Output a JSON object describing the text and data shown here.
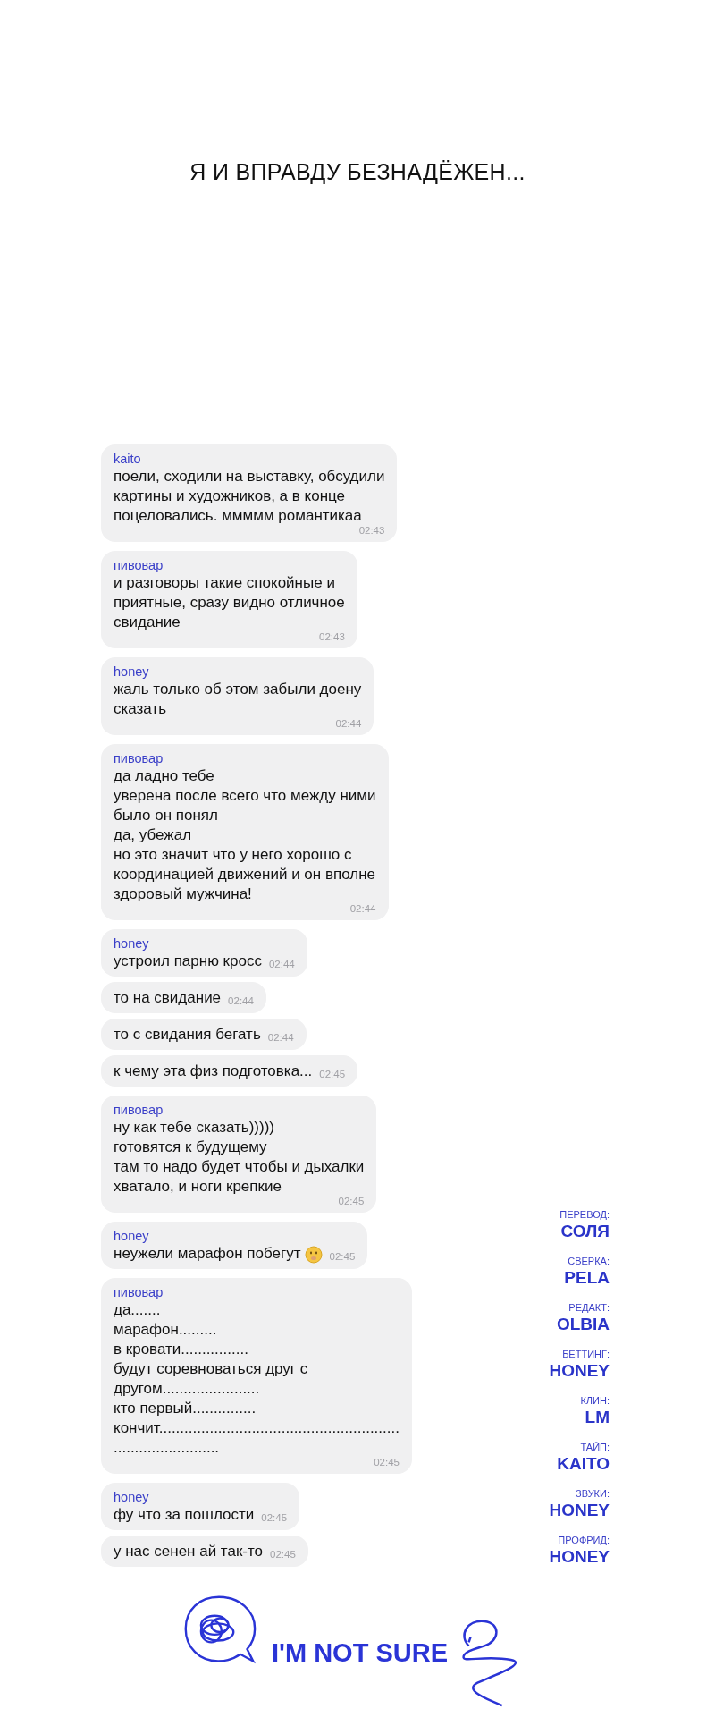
{
  "title": "Я И ВПРАВДУ БЕЗНАДЁЖЕН...",
  "messages": [
    {
      "sender": "kaito",
      "text": "поели, сходили на выставку, обсудили\nкартины и художников, а в конце\nпоцеловались. ммммм романтикаа",
      "time": "02:43",
      "emoji_icon": false
    },
    {
      "sender": "пивовар",
      "text": "и разговоры такие спокойные и\nприятные, сразу видно отличное\nсвидание",
      "time": "02:43",
      "emoji_icon": false
    },
    {
      "sender": "honey",
      "text": "жаль только об этом забыли доену\nсказать",
      "time": "02:44",
      "emoji_icon": false
    },
    {
      "sender": "пивовар",
      "text": "да ладно тебе\nуверена после всего что между ними\nбыло он понял\nда, убежал\nно это значит что у него хорошо с\nкоординацией движений и он вполне\nздоровый мужчина!",
      "time": "02:44",
      "emoji_icon": false
    },
    {
      "sender": "honey",
      "text": "устроил парню кросс",
      "time": "02:44",
      "emoji_icon": false
    },
    {
      "text": "то на свидание",
      "time": "02:44",
      "emoji_icon": false
    },
    {
      "text": "то с свидания бегать",
      "time": "02:44",
      "emoji_icon": false
    },
    {
      "text": "к чему эта физ подготовка...",
      "time": "02:45",
      "emoji_icon": false
    },
    {
      "sender": "пивовар",
      "text": "ну как тебе сказать)))))\nготовятся к будущему\nтам то надо будет чтобы и дыхалки\nхватало, и ноги крепкие",
      "time": "02:45",
      "emoji_icon": false
    },
    {
      "sender": "honey",
      "text": "неужели марафон побегут",
      "time": "02:45",
      "emoji_icon": true
    },
    {
      "sender": "пивовар",
      "text": "да.......\nмарафон.........\nв кровати................\nбудут соревноваться друг с\nдругом.......................\nкто первый...............\nкончит.........................................................\n.........................",
      "time": "02:45",
      "emoji_icon": false
    },
    {
      "sender": "honey",
      "text": "фу что за пошлости",
      "time": "02:45",
      "emoji_icon": false
    },
    {
      "text": "у нас сенен ай так-то",
      "time": "02:45",
      "emoji_icon": false
    }
  ],
  "credits": [
    {
      "role": "ПЕРЕВОД:",
      "name": "СОЛЯ"
    },
    {
      "role": "СВЕРКА:",
      "name": "PELA"
    },
    {
      "role": "РЕДАКТ:",
      "name": "OLBIA"
    },
    {
      "role": "БЕТТИНГ:",
      "name": "HONEY"
    },
    {
      "role": "КЛИН:",
      "name": "LM"
    },
    {
      "role": "ТАЙП:",
      "name": "KAITO"
    },
    {
      "role": "ЗВУКИ:",
      "name": "HONEY"
    },
    {
      "role": "ПРОФРИД:",
      "name": "HONEY"
    }
  ],
  "footer": {
    "logo_text": "I'M NOT SURE"
  }
}
